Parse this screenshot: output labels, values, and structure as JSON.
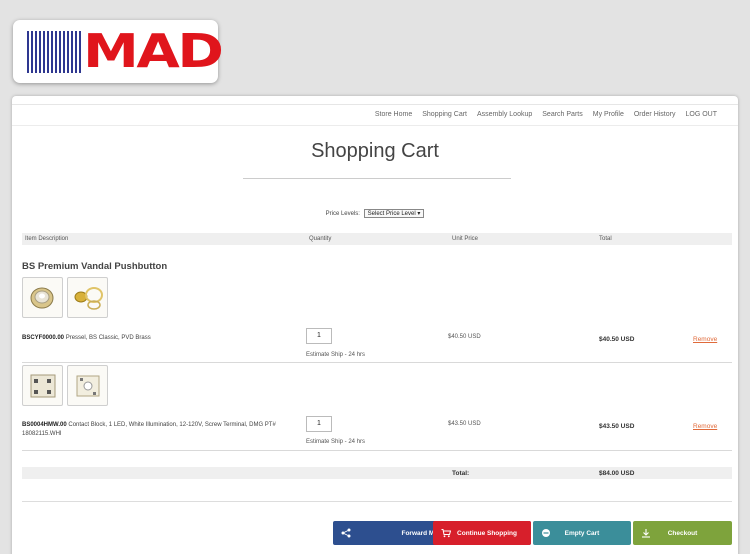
{
  "logo": {
    "text": "MAD"
  },
  "nav": {
    "items": [
      "Store Home",
      "Shopping Cart",
      "Assembly Lookup",
      "Search Parts",
      "My Profile",
      "Order History",
      "LOG OUT"
    ]
  },
  "page": {
    "title": "Shopping Cart"
  },
  "price_levels": {
    "label": "Price Levels:",
    "selected": "Select Price Level"
  },
  "table": {
    "headers": {
      "description": "Item Description",
      "quantity": "Quantity",
      "unit_price": "Unit Price",
      "total": "Total"
    }
  },
  "product": {
    "name": "BS Premium Vandal Pushbutton"
  },
  "items": [
    {
      "sku": "BSCYF0000.00",
      "description": "Pressel, BS Classic, PVD Brass",
      "quantity": "1",
      "ship": "Estimate Ship - 24 hrs",
      "unit_price": "$40.50 USD",
      "total": "$40.50 USD",
      "remove": "Remove"
    },
    {
      "sku": "BS0004HMW.00",
      "description": "Contact Block, 1 LED, White Illumination, 12-120V, Screw Terminal, DMG PT# 18082115.WHI",
      "quantity": "1",
      "ship": "Estimate Ship - 24 hrs",
      "unit_price": "$43.50 USD",
      "total": "$43.50 USD",
      "remove": "Remove"
    }
  ],
  "summary": {
    "label": "Total:",
    "value": "$84.00 USD"
  },
  "actions": {
    "forward": "Forward Mad Quote",
    "continue": "Continue Shopping",
    "empty": "Empty Cart",
    "checkout": "Checkout"
  },
  "colors": {
    "brand_red": "#e0151c",
    "brand_blue": "#2e3790",
    "forward_btn": "#2d4f8f",
    "continue_btn": "#d71f2b",
    "empty_btn": "#3b8e9a",
    "checkout_btn": "#7ea33c",
    "remove_link": "#e06a3a"
  }
}
